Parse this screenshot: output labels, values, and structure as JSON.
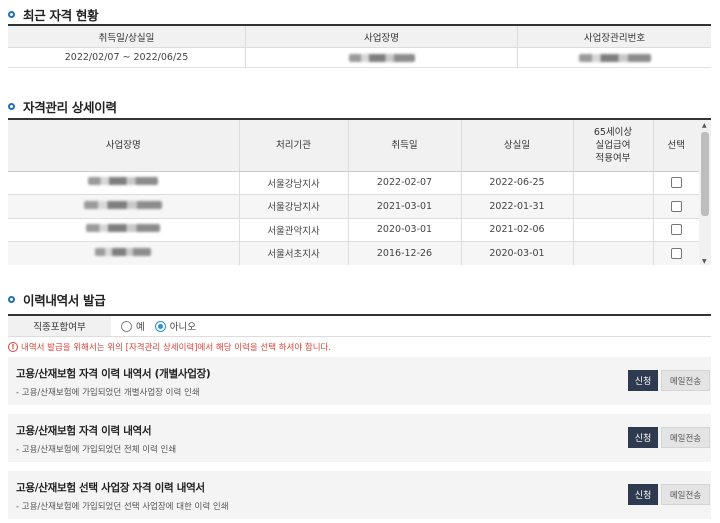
{
  "recent": {
    "title": "최근 자격 현황",
    "headers": [
      "취득일/상실일",
      "사업장명",
      "사업장관리번호"
    ],
    "row": {
      "period": "2022/02/07 ~ 2022/06/25"
    }
  },
  "detail": {
    "title": "자격관리 상세이력",
    "headers": [
      "사업장명",
      "처리기관",
      "취득일",
      "상실일",
      "65세이상\n실업급여\n적용여부",
      "선택"
    ],
    "rows": [
      {
        "agency": "서울강남지사",
        "acquired": "2022-02-07",
        "lost": "2022-06-25"
      },
      {
        "agency": "서울강남지사",
        "acquired": "2021-03-01",
        "lost": "2022-01-31"
      },
      {
        "agency": "서울관악지사",
        "acquired": "2020-03-01",
        "lost": "2021-02-06"
      },
      {
        "agency": "서울서초지사",
        "acquired": "2016-12-26",
        "lost": "2020-03-01"
      }
    ]
  },
  "issue": {
    "title": "이력내역서 발급",
    "option_label": "직종포함여부",
    "opt_yes": "예",
    "opt_no": "아니오",
    "selected": "아니오",
    "notice": "내역서 발급을 위해서는 위의 [자격관리 상세이력]에서 해당 이력을 선택 하셔야 합니다.",
    "docs": [
      {
        "title": "고용/산재보험 자격 이력 내역서 (개별사업장)",
        "desc": "- 고용/산재보험에 가입되었던 개별사업장 이력 인쇄",
        "apply": "신청",
        "mail": "메일전송"
      },
      {
        "title": "고용/산재보험 자격 이력 내역서",
        "desc": "- 고용/산재보험에 가입되었던 전체 이력 인쇄",
        "apply": "신청",
        "mail": "메일전송"
      },
      {
        "title": "고용/산재보험 선택 사업장 자격 이력 내역서",
        "desc": "- 고용/산재보험에 가입되었던 선택 사업장에 대한 이력 인쇄",
        "apply": "신청",
        "mail": "메일전송"
      }
    ]
  },
  "colors": {
    "accent": "#1f6fb5",
    "button_dark": "#2e3a4f",
    "warning": "#d9433a"
  },
  "icons": {
    "section_bullet": "circle-bullet-icon",
    "notice": "warning-circle-icon",
    "radio": "radio-icon",
    "checkbox": "checkbox-icon"
  }
}
